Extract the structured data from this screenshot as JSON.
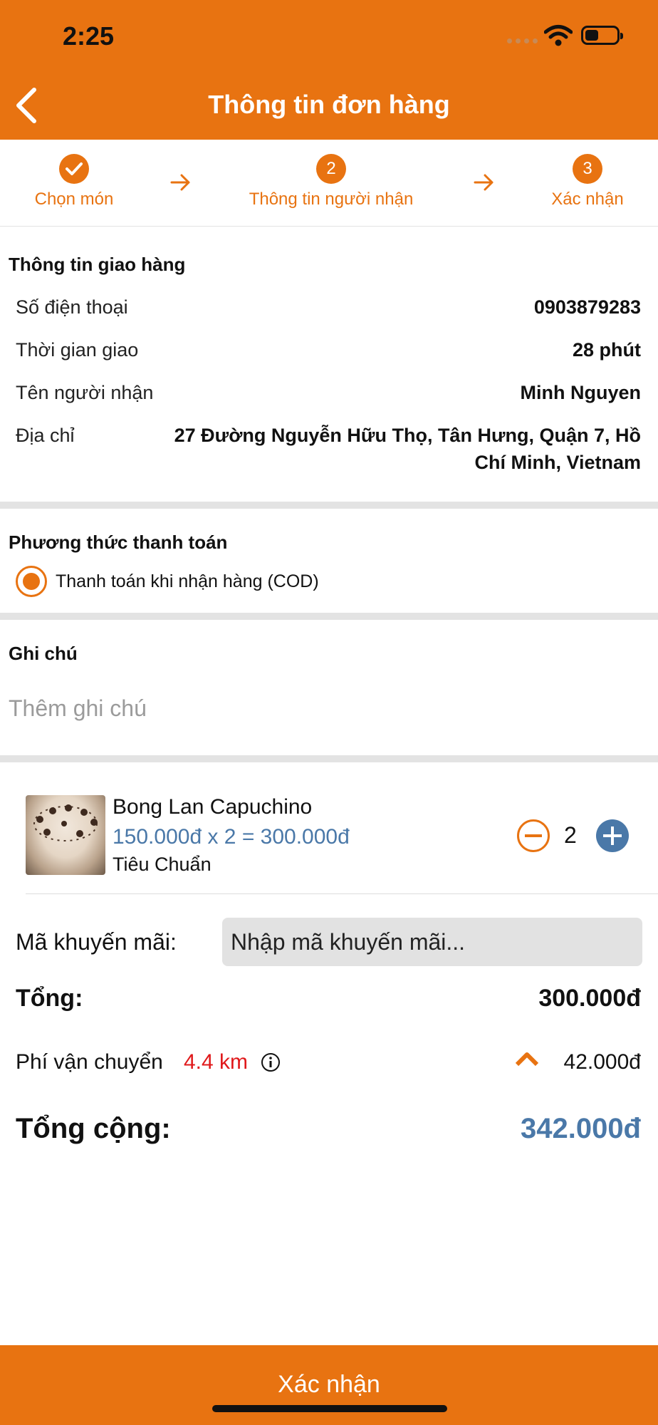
{
  "status": {
    "time": "2:25"
  },
  "header": {
    "title": "Thông tin đơn hàng"
  },
  "steps": [
    {
      "label": "Chọn món",
      "number": ""
    },
    {
      "label": "Thông tin người nhận",
      "number": "2"
    },
    {
      "label": "Xác nhận",
      "number": "3"
    }
  ],
  "delivery": {
    "title": "Thông tin giao hàng",
    "phone_label": "Số điện thoại",
    "phone_value": "0903879283",
    "time_label": "Thời gian giao",
    "time_value": "28 phút",
    "name_label": "Tên người nhận",
    "name_value": "Minh Nguyen",
    "address_label": "Địa chỉ",
    "address_line1": "27 Đường Nguyễn Hữu Thọ, Tân Hưng, Quận 7, Hồ",
    "address_line2": "Chí Minh, Vietnam"
  },
  "payment": {
    "title": "Phương thức thanh toán",
    "option": "Thanh toán khi nhận hàng (COD)"
  },
  "note": {
    "title": "Ghi chú",
    "placeholder": "Thêm ghi chú"
  },
  "item": {
    "name": "Bong Lan Capuchino",
    "price_line": "150.000đ x 2 = 300.000đ",
    "variant": "Tiêu Chuẩn",
    "quantity": "2"
  },
  "promo": {
    "label": "Mã khuyến mãi:",
    "placeholder": "Nhập mã khuyến mãi..."
  },
  "summary": {
    "subtotal_label": "Tổng:",
    "subtotal_value": "300.000đ",
    "shipping_label": "Phí vận chuyển",
    "shipping_distance": "4.4 km",
    "shipping_value": "42.000đ",
    "total_label": "Tổng cộng:",
    "total_value": "342.000đ"
  },
  "footer": {
    "confirm_label": "Xác nhận"
  },
  "colors": {
    "accent": "#E87311",
    "price_blue": "#4a78a8",
    "distance_red": "#e0191b"
  }
}
